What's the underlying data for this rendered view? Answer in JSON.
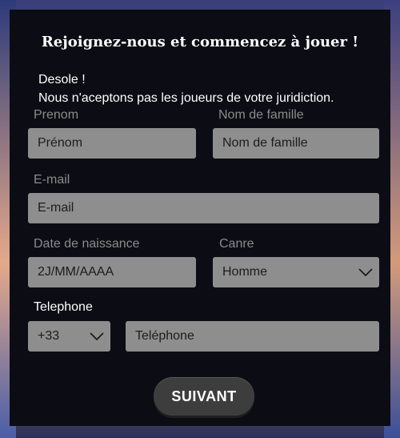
{
  "title": "Rejoignez-nous et commencez à jouer !",
  "notice": {
    "line1": "Desole !",
    "line2": "Nous n'aceptons pas les joueurs de votre juridiction."
  },
  "form": {
    "first_name": {
      "label": "Prenom",
      "value": "Prénom"
    },
    "last_name": {
      "label": "Nom de famille",
      "value": "Nom de famille"
    },
    "email": {
      "label": "E-mail",
      "value": "E-mail"
    },
    "birthdate": {
      "label": "Date de naissance",
      "value": "2J/MM/AAAA"
    },
    "gender": {
      "label": "Canre",
      "value": "Homme",
      "icon": "chevron-down-icon"
    },
    "phone": {
      "label": "Telephone",
      "code": "+33",
      "code_icon": "chevron-down-icon",
      "value": "Teléphone"
    }
  },
  "submit_label": "SUIVANT",
  "colors": {
    "panel_bg": "#0c0d14",
    "field_bg": "#8e8e8e",
    "label_gray": "#8b8b8b",
    "button_bg": "#3d3d3d"
  }
}
